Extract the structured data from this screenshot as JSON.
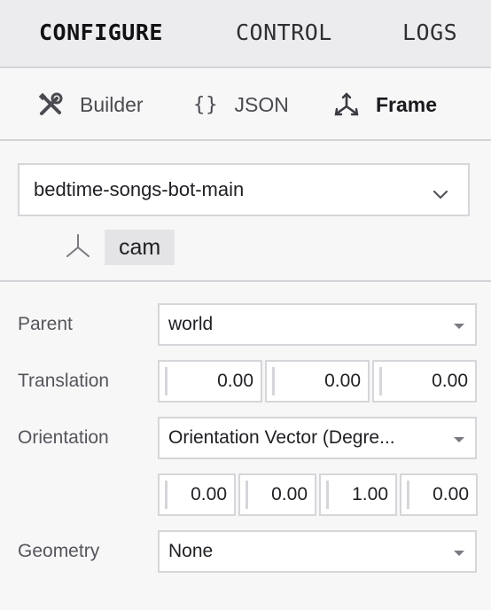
{
  "top_tabs": [
    {
      "label": "CONFIGURE",
      "active": true
    },
    {
      "label": "CONTROL",
      "active": false
    },
    {
      "label": "LOGS",
      "active": false
    }
  ],
  "sub_tabs": [
    {
      "label": "Builder",
      "icon": "wrench-screwdriver-icon",
      "active": false
    },
    {
      "label": "JSON",
      "icon": "braces-icon",
      "icon_text": "{}",
      "active": false
    },
    {
      "label": "Frame",
      "icon": "frame-axes-icon",
      "active": true
    }
  ],
  "frame_select": {
    "value": "bedtime-songs-bot-main",
    "icon": "chevron-down-icon"
  },
  "tree": {
    "label": "cam",
    "icon": "frame-axes-icon"
  },
  "form": {
    "parent": {
      "label": "Parent",
      "value": "world"
    },
    "translation": {
      "label": "Translation",
      "values": [
        "0.00",
        "0.00",
        "0.00"
      ]
    },
    "orientation": {
      "label": "Orientation",
      "value": "Orientation Vector (Degre...",
      "values": [
        "0.00",
        "0.00",
        "1.00",
        "0.00"
      ]
    },
    "geometry": {
      "label": "Geometry",
      "value": "None"
    }
  },
  "colors": {
    "background": "#f7f7f8",
    "topbar": "#ececef",
    "border": "#d4d4d8",
    "selected": "#e4e4e7"
  }
}
